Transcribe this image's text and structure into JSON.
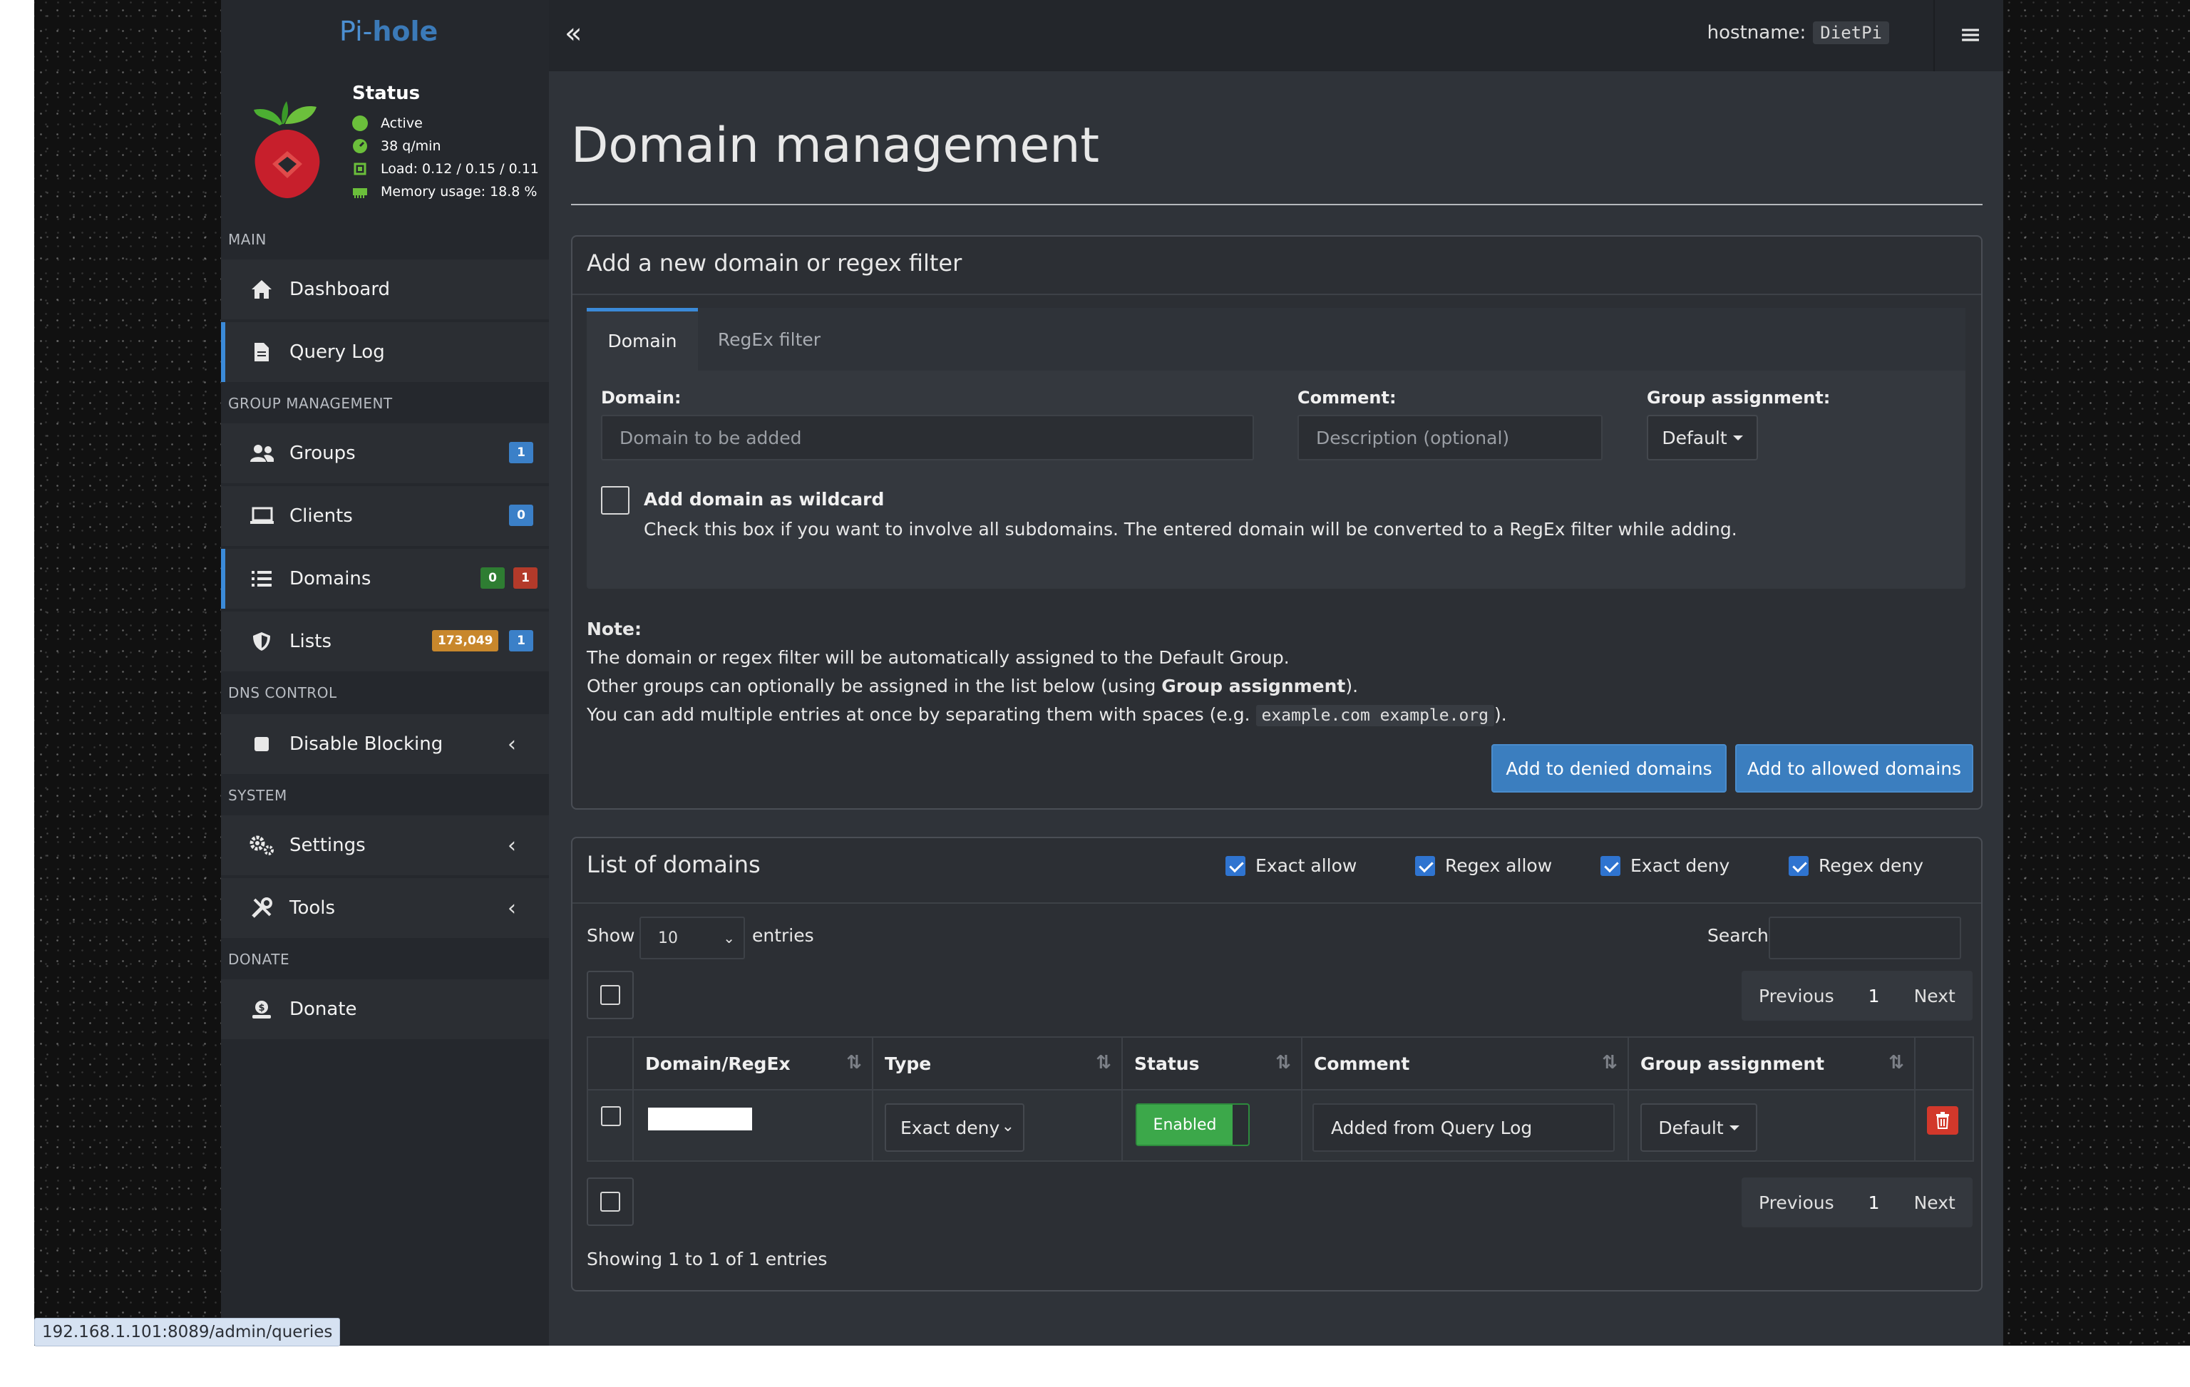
{
  "app": {
    "logo": {
      "pi": "Pi-",
      "hole": "hole"
    },
    "hostname_label": "hostname:",
    "hostname_value": "DietPi"
  },
  "status": {
    "title": "Status",
    "active": "Active",
    "qpm": "38 q/min",
    "load": "Load: 0.12 / 0.15 / 0.11",
    "memory": "Memory usage: 18.8 %",
    "colors": {
      "ok": "#6bbf3b"
    }
  },
  "sidebar": {
    "sections": {
      "main": "MAIN",
      "group_management": "GROUP MANAGEMENT",
      "dns_control": "DNS CONTROL",
      "system": "SYSTEM",
      "donate": "DONATE"
    },
    "items": [
      {
        "label": "Dashboard",
        "icon": "home-icon"
      },
      {
        "label": "Query Log",
        "icon": "file-icon"
      },
      {
        "label": "Groups",
        "icon": "users-icon",
        "badge": "1"
      },
      {
        "label": "Clients",
        "icon": "laptop-icon",
        "badge": "0"
      },
      {
        "label": "Domains",
        "icon": "list-icon",
        "badges": [
          "0",
          "1"
        ]
      },
      {
        "label": "Lists",
        "icon": "shield-icon",
        "badges": [
          "173,049",
          "1"
        ]
      },
      {
        "label": "Disable Blocking",
        "icon": "stop-icon"
      },
      {
        "label": "Settings",
        "icon": "gears-icon"
      },
      {
        "label": "Tools",
        "icon": "tools-icon"
      },
      {
        "label": "Donate",
        "icon": "donate-icon"
      }
    ]
  },
  "main": {
    "page_title": "Domain management",
    "add_box": {
      "title": "Add a new domain or regex filter",
      "tabs": [
        "Domain",
        "RegEx filter"
      ],
      "domain_label": "Domain:",
      "domain_placeholder": "Domain to be added",
      "comment_label": "Comment:",
      "comment_placeholder": "Description (optional)",
      "group_label": "Group assignment:",
      "group_value": "Default",
      "wildcard_label": "Add domain as wildcard",
      "wildcard_help": "Check this box if you want to involve all subdomains. The entered domain will be converted to a RegEx filter while adding.",
      "note_title": "Note:",
      "note_1": "The domain or regex filter will be automatically assigned to the Default Group.",
      "note_2_pre": "Other groups can optionally be assigned in the list below (using ",
      "note_2_bold": "Group assignment",
      "note_2_post": ").",
      "note_3_pre": "You can add multiple entries at once by separating them with spaces (e.g. ",
      "note_3_code": "example.com example.org",
      "note_3_post": ").",
      "btn_deny": "Add to denied domains",
      "btn_allow": "Add to allowed domains"
    },
    "list_box": {
      "title": "List of domains",
      "filters": [
        "Exact allow",
        "Regex allow",
        "Exact deny",
        "Regex deny"
      ],
      "show": "Show",
      "entries_value": "10",
      "entries": "entries",
      "search_label": "Search:",
      "pager": {
        "prev": "Previous",
        "page": "1",
        "next": "Next"
      },
      "columns": [
        "Domain/RegEx",
        "Type",
        "Status",
        "Comment",
        "Group assignment"
      ],
      "rows": [
        {
          "domain": "",
          "type": "Exact deny",
          "status": "Enabled",
          "comment": "Added from Query Log",
          "group": "Default"
        }
      ],
      "info": "Showing 1 to 1 of 1 entries"
    }
  },
  "statusbar_url": "192.168.1.101:8089/admin/queries"
}
